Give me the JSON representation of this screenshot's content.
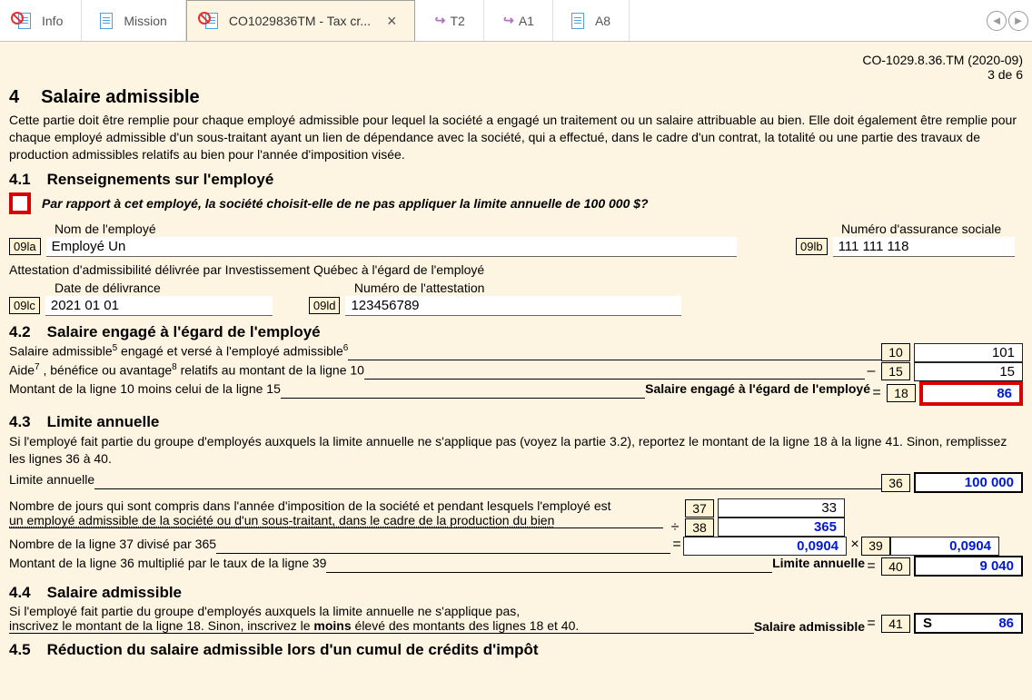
{
  "tabs": {
    "info": "Info",
    "mission": "Mission",
    "active": "CO1029836TM - Tax cr...",
    "t2": "T2",
    "a1": "A1",
    "a8": "A8"
  },
  "header": {
    "formid": "CO-1029.8.36.TM (2020-09)",
    "pagenum": "3 de 6"
  },
  "s4": {
    "num": "4",
    "title": "Salaire admissible",
    "intro": "Cette partie doit être remplie pour chaque employé admissible pour lequel la société a engagé un traitement ou un salaire attribuable au bien. Elle doit également être remplie pour chaque employé admissible d'un sous-traitant ayant un lien de dépendance avec la société, qui a effectué, dans le cadre d'un contrat, la totalité ou une partie des travaux de production admissibles relatifs au bien pour l'année d'imposition visée."
  },
  "s41": {
    "num": "4.1",
    "title": "Renseignements sur l'employé",
    "question": "Par rapport à cet employé, la société choisit-elle de ne pas appliquer la limite annuelle de 100 000 $?",
    "name_lbl": "Nom de l'employé",
    "name_code": "09la",
    "name_val": "Employé Un",
    "sin_lbl": "Numéro d'assurance sociale",
    "sin_code": "09lb",
    "sin_val": "111 111 118",
    "attest": "Attestation d'admissibilité délivrée par Investissement Québec à l'égard de l'employé",
    "date_lbl": "Date de délivrance",
    "date_code": "09lc",
    "date_val": "2021 01 01",
    "certno_lbl": "Numéro de l'attestation",
    "certno_code": "09ld",
    "certno_val": "123456789"
  },
  "s42": {
    "num": "4.2",
    "title": "Salaire engagé à l'égard de l'employé",
    "l10_a": "Salaire admissible",
    "l10_b": " engagé et versé à l'employé admissible",
    "l10_num": "10",
    "l10_val": "101",
    "l15_a": "Aide",
    "l15_b": " , bénéfice ou avantage",
    "l15_c": " relatifs au montant de la ligne 10",
    "l15_num": "15",
    "l15_val": "15",
    "l18_desc": "Montant de la ligne 10 moins celui de la ligne 15",
    "l18_right": "Salaire engagé à l'égard de l'employé",
    "l18_num": "18",
    "l18_val": "86"
  },
  "s43": {
    "num": "4.3",
    "title": "Limite annuelle",
    "intro": "Si l'employé fait partie du groupe d'employés auxquels la limite annuelle ne s'applique pas (voyez la partie 3.2), reportez le montant de la ligne 18 à la ligne 41. Sinon, remplissez les lignes 36 à 40.",
    "l36_desc": "Limite annuelle",
    "l36_num": "36",
    "l36_val": "100 000",
    "l37p1": "Nombre de jours qui sont compris dans l'année d'imposition de la société et pendant lesquels l'employé est",
    "l37p2": "un employé admissible de la société ou d'un sous-traitant, dans le cadre de la production du bien",
    "l37_num": "37",
    "l37_val": "33",
    "l38_num": "38",
    "l38_val": "365",
    "l38r_desc": "Nombre de la ligne 37 divisé par 365",
    "l38r_val": "0,0904",
    "l39_num": "39",
    "l39_val": "0,0904",
    "l40_desc": "Montant de la ligne 36 multiplié par le taux de la ligne 39",
    "l40_right": "Limite annuelle",
    "l40_num": "40",
    "l40_val": "9 040"
  },
  "s44": {
    "num": "4.4",
    "title": "Salaire admissible",
    "p1": "Si l'employé fait partie du groupe d'employés auxquels la limite annuelle ne s'applique pas,",
    "p2a": "inscrivez le montant de la ligne 18. Sinon, inscrivez le ",
    "p2b": "moins",
    "p2c": " élevé des montants des lignes 18 et 40.",
    "right": "Salaire admissible",
    "l41_num": "41",
    "l41_prefix": "S",
    "l41_val": "86"
  },
  "s45": {
    "num": "4.5",
    "title": "Réduction du salaire admissible lors d'un cumul de crédits d'impôt"
  }
}
